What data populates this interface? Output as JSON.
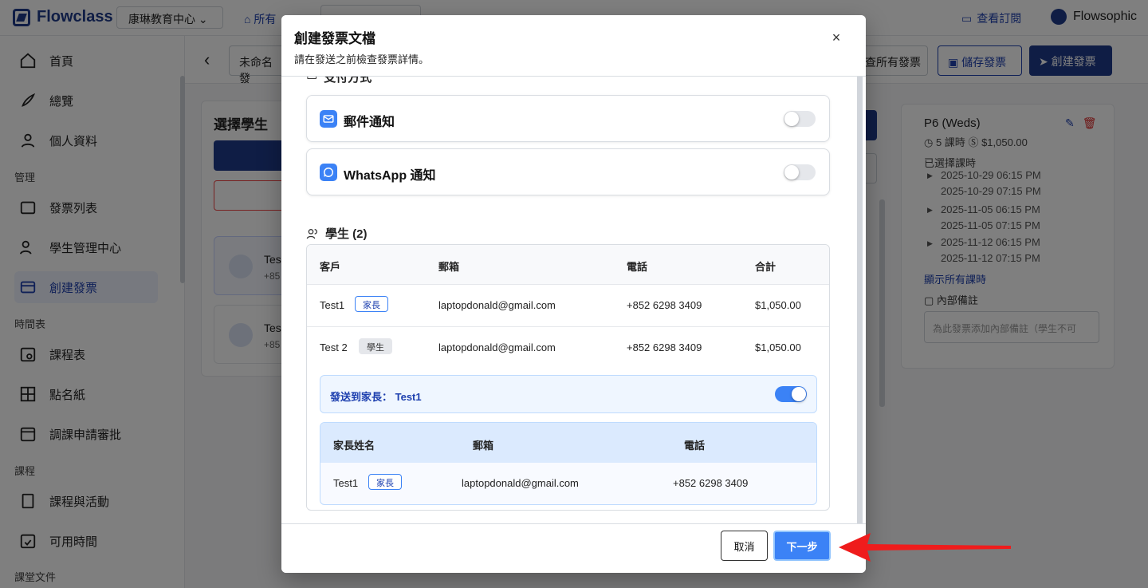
{
  "app": {
    "logo": "Flowclass",
    "org": "康琳教育中心",
    "filter": "所有",
    "subscription": "查看訂閱",
    "user": "Flowsophic"
  },
  "sidebar": {
    "items": [
      {
        "label": "首頁"
      },
      {
        "label": "總覽"
      },
      {
        "label": "個人資料"
      }
    ],
    "section_manage": "管理",
    "manage_items": [
      {
        "label": "發票列表"
      },
      {
        "label": "學生管理中心"
      },
      {
        "label": "創建發票"
      }
    ],
    "section_timetable": "時間表",
    "timetable_items": [
      {
        "label": "課程表"
      },
      {
        "label": "點名紙"
      },
      {
        "label": "調課申請審批"
      }
    ],
    "section_course": "課程",
    "course_items": [
      {
        "label": "課程與活動"
      },
      {
        "label": "可用時間"
      }
    ],
    "section_docs": "課堂文件"
  },
  "header": {
    "title_input": "未命名發",
    "all_invoices": "查所有發票",
    "save": "儲存發票",
    "create": "創建發票"
  },
  "select_panel": {
    "title": "選擇學生",
    "student_a": "Tes",
    "student_a_sub": "+85",
    "student_b": "Tes",
    "student_b_sub": "+85"
  },
  "course_card": {
    "title": "P6 (Weds)",
    "lessons": "5 課時",
    "price": "$1,050.00",
    "selected_label": "已選擇課時",
    "times": [
      [
        "2025-10-29 06:15 PM",
        "2025-10-29 07:15 PM"
      ],
      [
        "2025-11-05 06:15 PM",
        "2025-11-05 07:15 PM"
      ],
      [
        "2025-11-12 06:15 PM",
        "2025-11-12 07:15 PM"
      ]
    ],
    "show_all": "顯示所有課時",
    "note_label": "內部備註",
    "note_placeholder": "為此發票添加內部備註（學生不可"
  },
  "modal": {
    "title": "創建發票文檔",
    "subtitle": "請在發送之前檢查發票詳情。",
    "section_cut": "支付方式",
    "email_label": "郵件通知",
    "whatsapp_label": "WhatsApp 通知",
    "email_enabled": false,
    "whatsapp_enabled": false,
    "students_title": "學生 (2)",
    "table": {
      "headers": [
        "客戶",
        "郵箱",
        "電話",
        "合計"
      ],
      "rows": [
        {
          "name": "Test1",
          "tag": "家長",
          "email": "laptopdonald@gmail.com",
          "phone": "+852 6298 3409",
          "total": "$1,050.00"
        },
        {
          "name": "Test 2",
          "tag": "學生",
          "email": "laptopdonald@gmail.com",
          "phone": "+852 6298 3409",
          "total": "$1,050.00"
        }
      ]
    },
    "send_parent_label": "發送到家長： Test1",
    "send_parent_enabled": true,
    "parent_table": {
      "headers": [
        "家長姓名",
        "郵箱",
        "電話"
      ],
      "row": {
        "name": "Test1",
        "tag": "家長",
        "email": "laptopdonald@gmail.com",
        "phone": "+852 6298 3409"
      }
    },
    "cancel": "取消",
    "next": "下一步"
  },
  "colors": {
    "brand": "#1e3a8a",
    "primary": "#3b82f6",
    "annotation_arrow": "#ef1c1c"
  }
}
